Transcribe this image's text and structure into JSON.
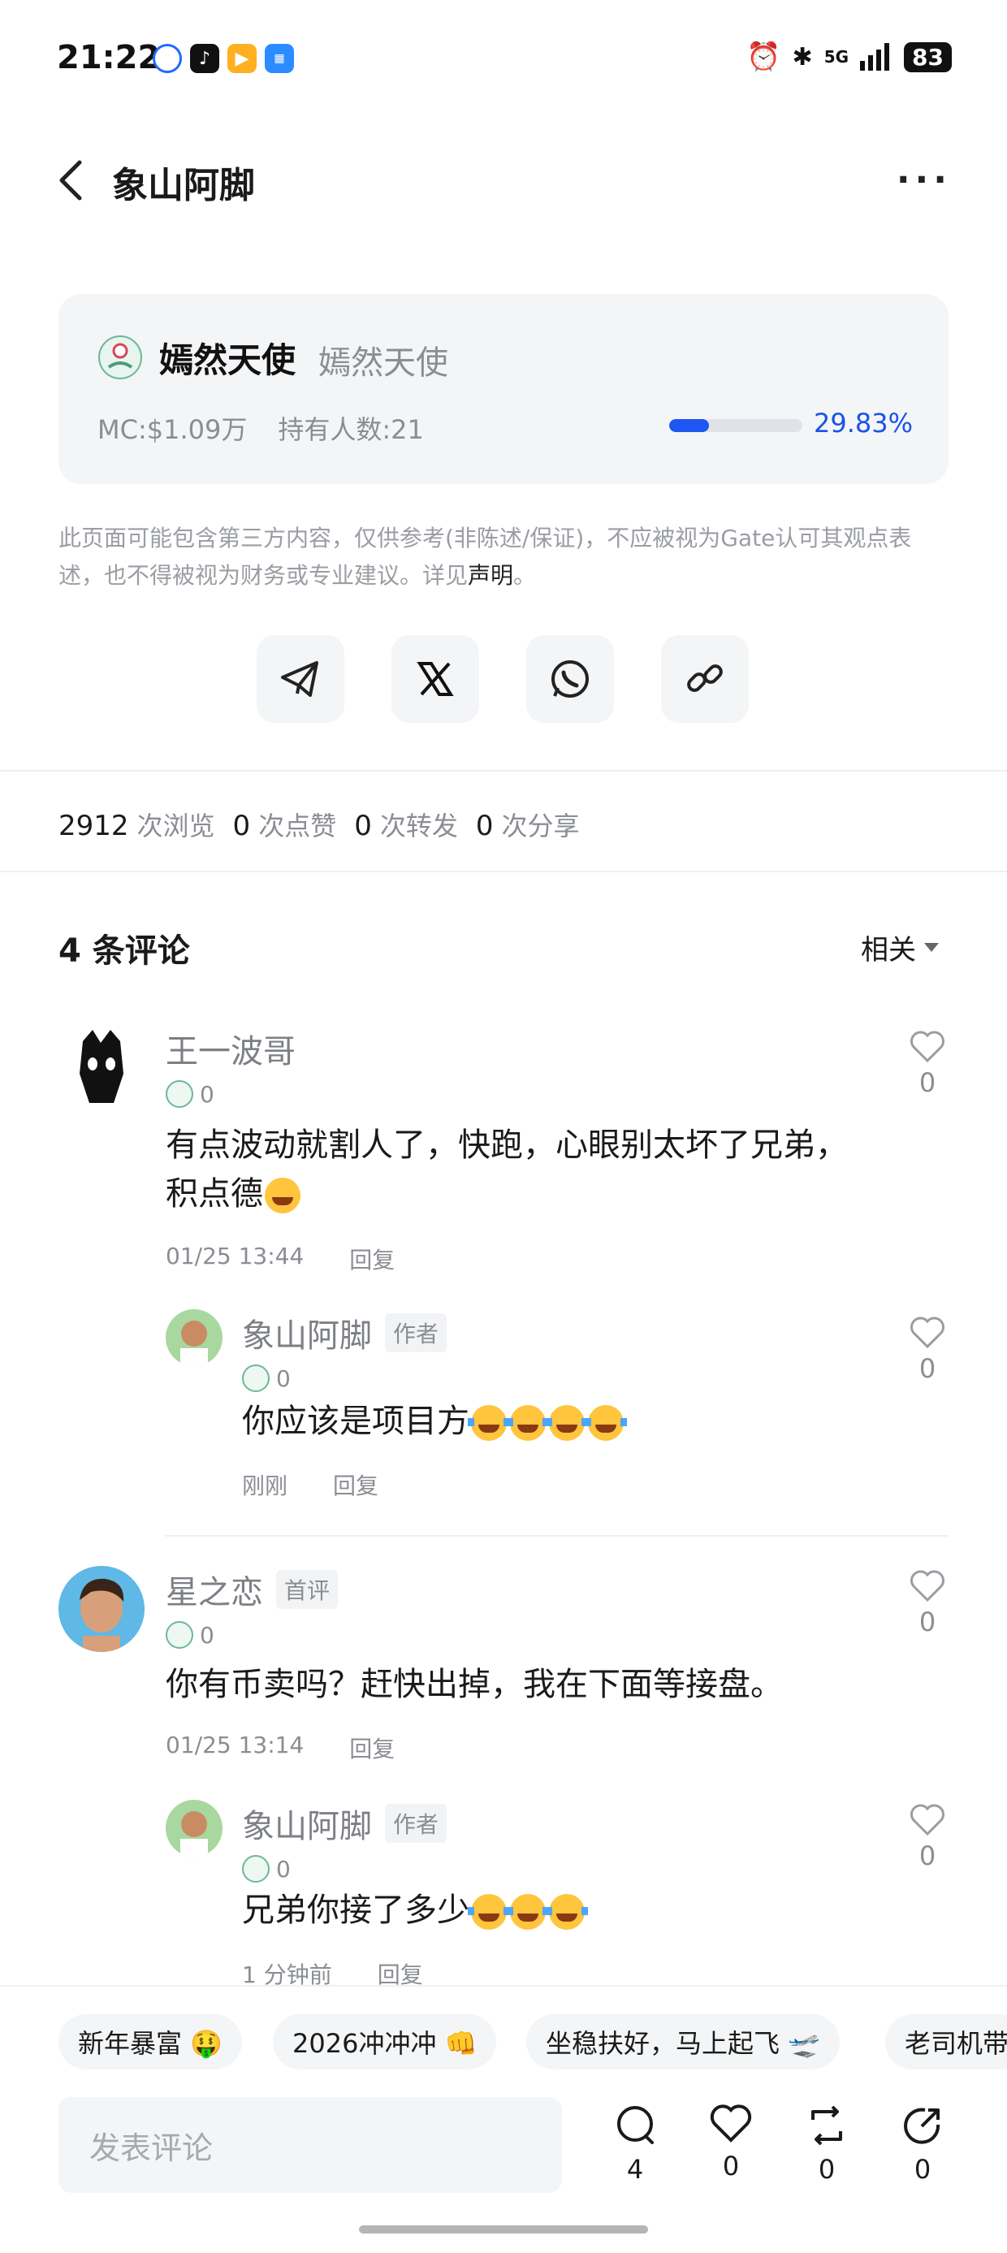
{
  "status_bar": {
    "time": "21:22",
    "network": "5G",
    "battery": "83"
  },
  "header": {
    "title": "象山阿脚",
    "more": "···"
  },
  "token": {
    "name": "嫣然天使",
    "symbol": "嫣然天使",
    "mc": "MC:$1.09万",
    "holders": "持有人数:21",
    "progress_text": "29.83%",
    "progress_fraction": 0.2983
  },
  "disclaimer": {
    "text": "此页面可能包含第三方内容，仅供参考(非陈述/保证)，不应被视为Gate认可其观点表述，也不得被视为财务或专业建议。详见",
    "link": "声明",
    "end": "。"
  },
  "share": [
    "telegram-icon",
    "x-icon",
    "whatsapp-icon",
    "link-icon"
  ],
  "stats": {
    "views": "2912",
    "views_label": "次浏览",
    "likes": "0",
    "likes_label": "次点赞",
    "reposts": "0",
    "reposts_label": "次转发",
    "shares": "0",
    "shares_label": "次分享"
  },
  "comments_header": {
    "title": "4 条评论",
    "sort": "相关"
  },
  "comments": [
    {
      "user": "王一波哥",
      "token_count": "0",
      "text": "有点波动就割人了，快跑，心眼别太坏了兄弟，",
      "text2": "积点德",
      "time": "01/25 13:44",
      "reply": "回复",
      "likes": "0"
    },
    {
      "user": "象山阿脚",
      "badge": "作者",
      "token_count": "0",
      "text": "你应该是项目方",
      "time": "刚刚",
      "reply": "回复",
      "likes": "0"
    },
    {
      "user": "星之恋",
      "badge": "首评",
      "token_count": "0",
      "text": "你有币卖吗？赶快出掉，我在下面等接盘。",
      "time": "01/25 13:14",
      "reply": "回复",
      "likes": "0"
    },
    {
      "user": "象山阿脚",
      "badge": "作者",
      "token_count": "0",
      "text": "兄弟你接了多少",
      "time": "1 分钟前",
      "reply": "回复",
      "likes": "0"
    }
  ],
  "chips": [
    "新年暴富 🤑",
    "2026冲冲冲 👊",
    "坐稳扶好，马上起飞 🛫",
    "老司机带"
  ],
  "input": {
    "placeholder": "发表评论"
  },
  "actions": {
    "comments": "4",
    "likes": "0",
    "reposts": "0",
    "shares": "0"
  },
  "colors": {
    "accent": "#1f55f0",
    "card_bg": "#f4f5f7"
  }
}
